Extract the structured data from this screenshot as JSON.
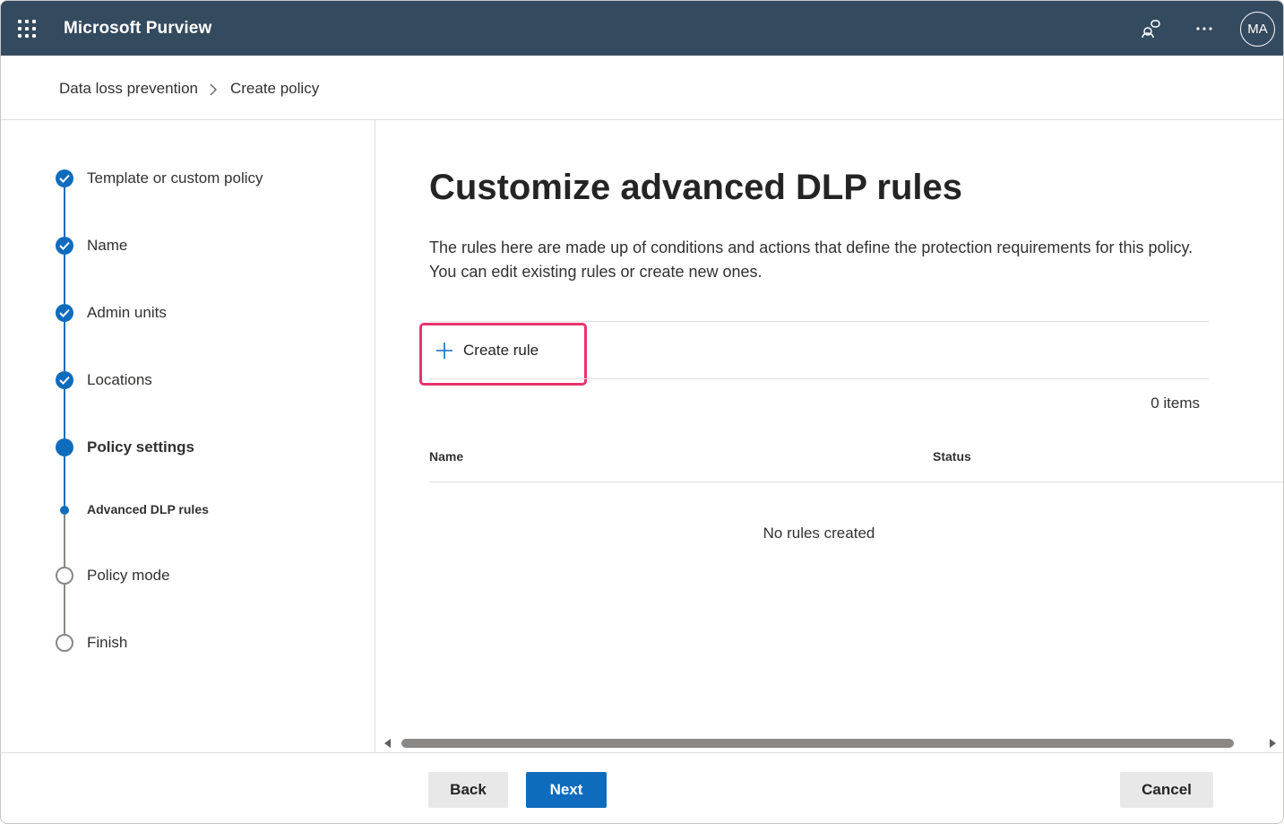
{
  "header": {
    "app_title": "Microsoft Purview",
    "icons": [
      "app-launcher-icon",
      "feedback-icon",
      "more-icon"
    ],
    "avatar_initials": "MA"
  },
  "breadcrumb": {
    "items": [
      "Data loss prevention",
      "Create policy"
    ]
  },
  "steps": [
    {
      "label": "Template or custom policy",
      "state": "done"
    },
    {
      "label": "Name",
      "state": "done"
    },
    {
      "label": "Admin units",
      "state": "done"
    },
    {
      "label": "Locations",
      "state": "done"
    },
    {
      "label": "Policy settings",
      "state": "current"
    },
    {
      "label": "Advanced DLP rules",
      "state": "current-substep"
    },
    {
      "label": "Policy mode",
      "state": "todo"
    },
    {
      "label": "Finish",
      "state": "todo"
    }
  ],
  "main": {
    "title": "Customize advanced DLP rules",
    "description": "The rules here are made up of conditions and actions that define the protection requirements for this policy. You can edit existing rules or create new ones.",
    "create_rule_label": "Create rule",
    "items_count": "0 items",
    "columns": [
      "Name",
      "Status"
    ],
    "empty_message": "No rules created"
  },
  "footer": {
    "back_label": "Back",
    "next_label": "Next",
    "cancel_label": "Cancel"
  },
  "colors": {
    "topbar": "#344a5f",
    "accent": "#0f6cbd",
    "highlight": "#e8346e"
  }
}
